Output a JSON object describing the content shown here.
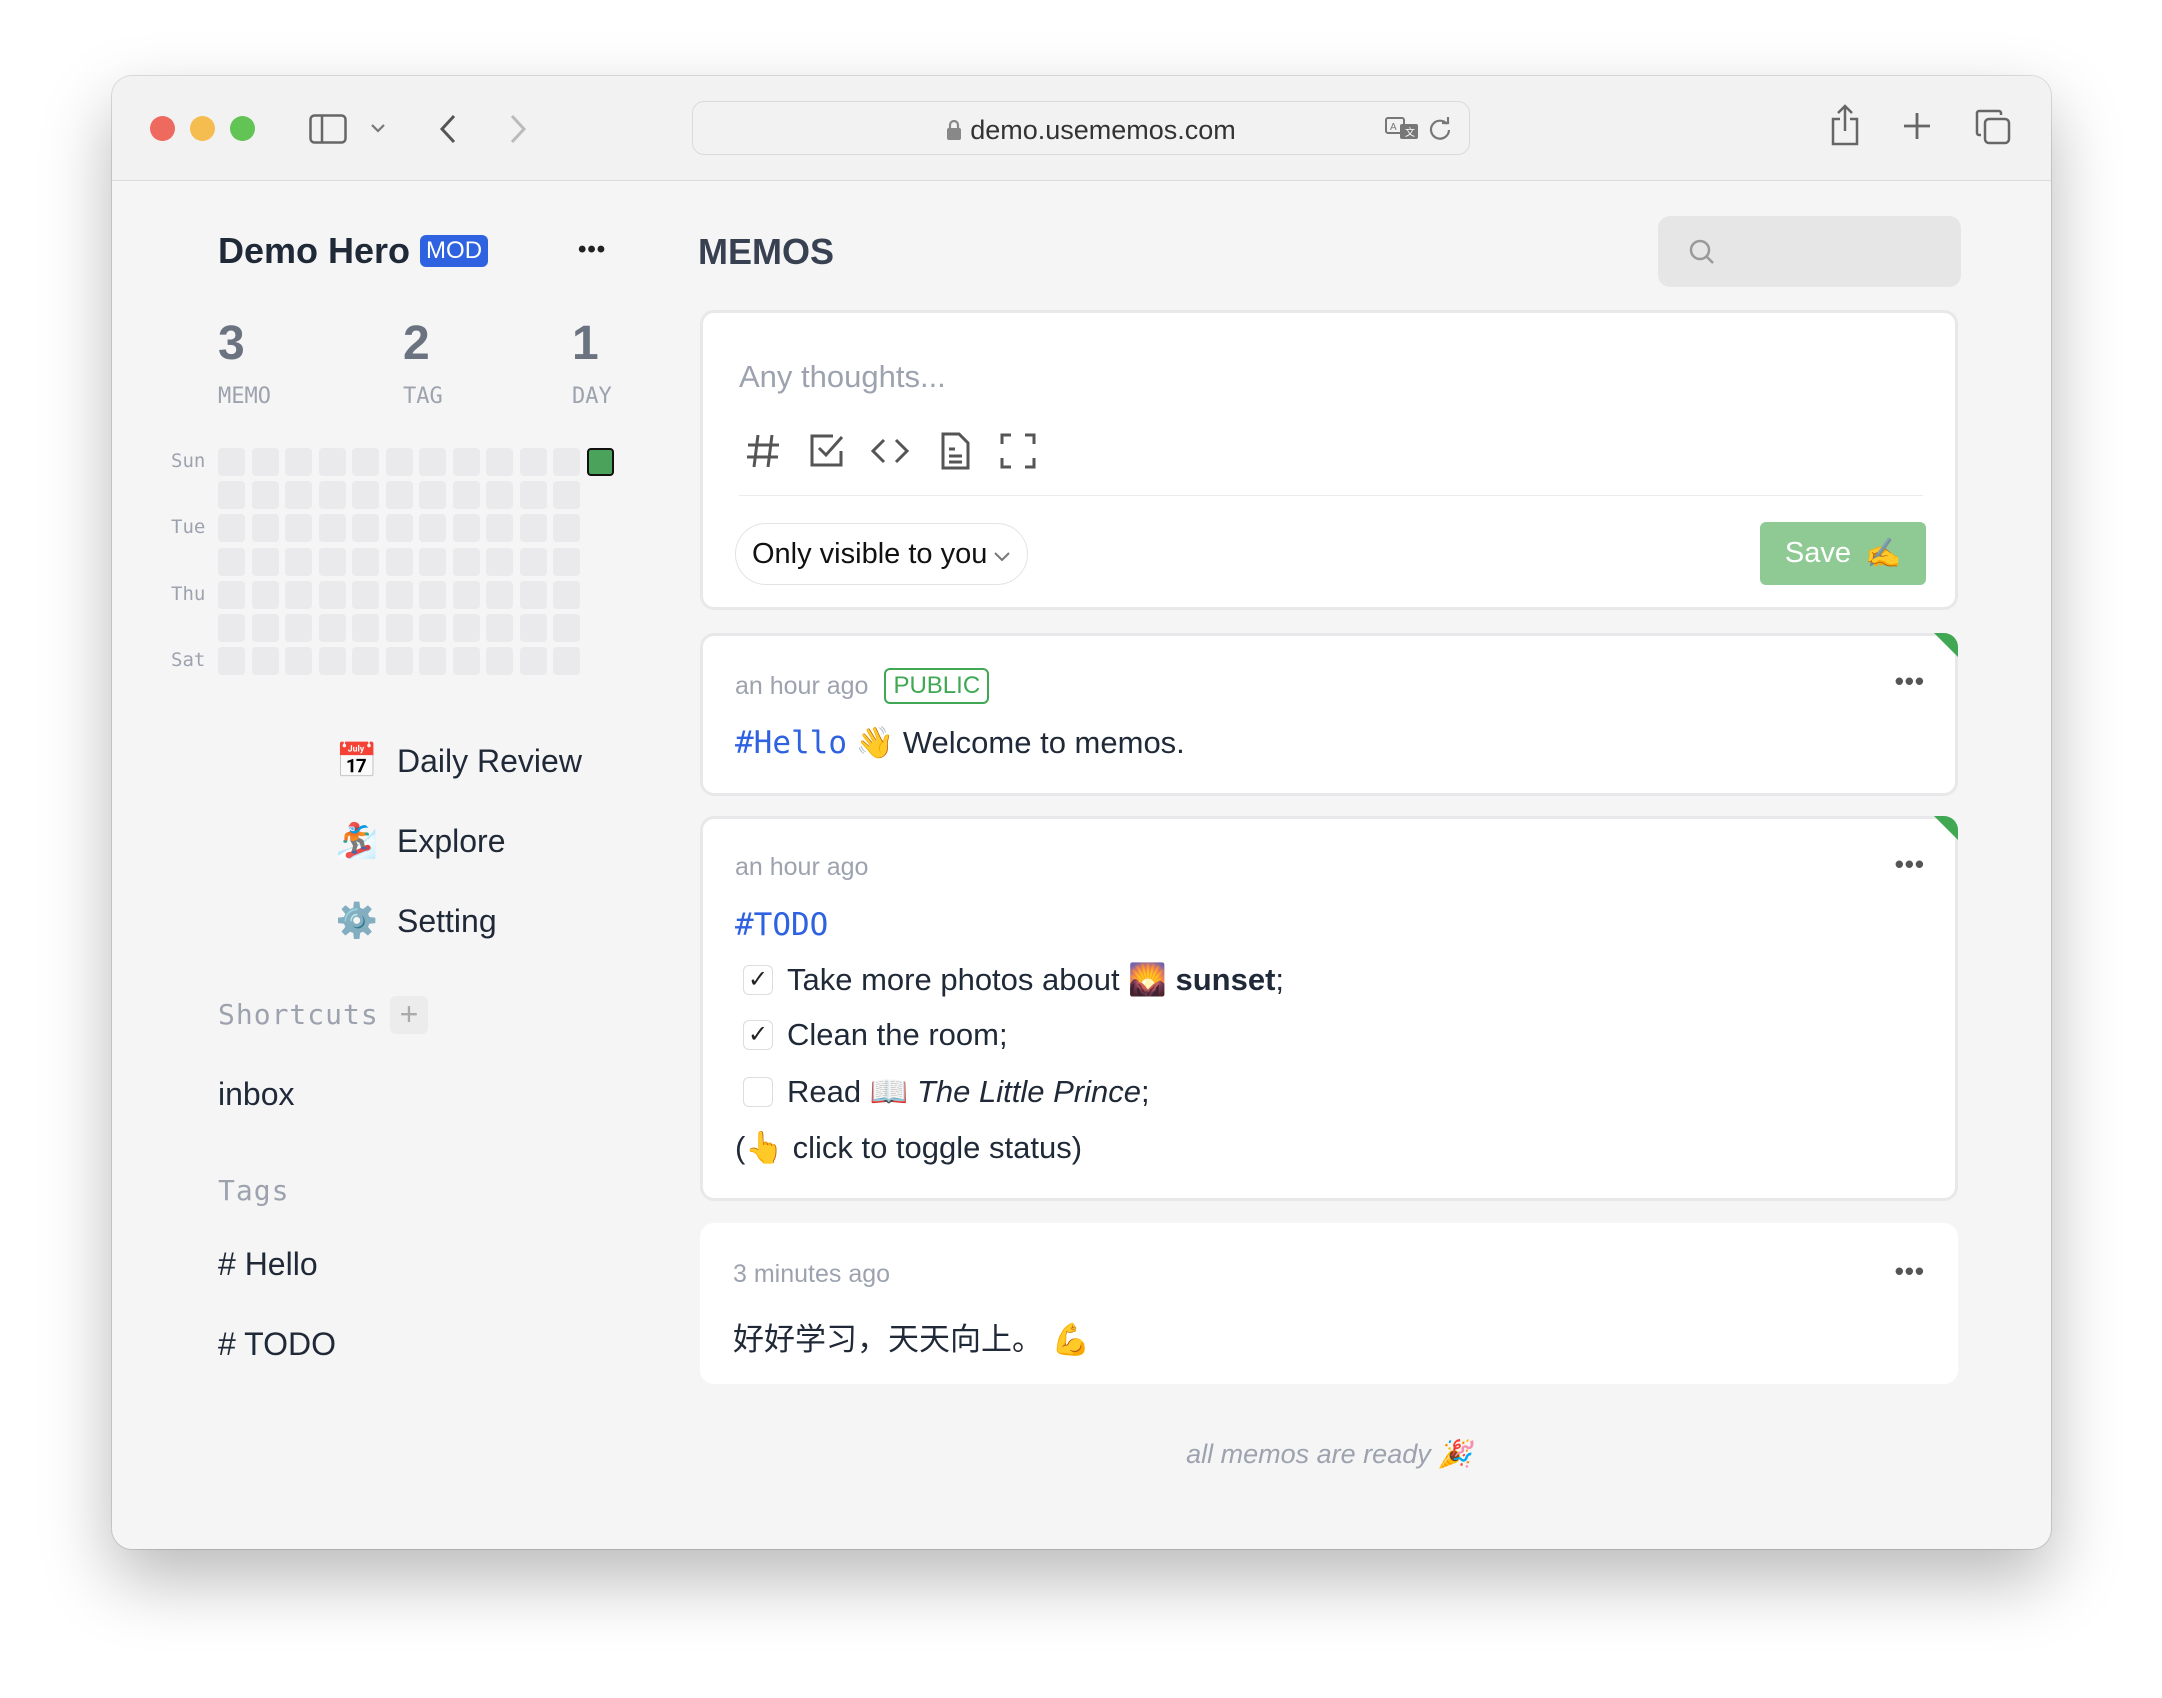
{
  "browser": {
    "url": "demo.usememos.com",
    "icons": [
      "sidebar-icon",
      "chevron-down-icon",
      "back-icon",
      "forward-icon",
      "lock-icon",
      "translate-icon",
      "reload-icon",
      "share-icon",
      "new-tab-icon",
      "tabs-overview-icon"
    ]
  },
  "sidebar": {
    "username": "Demo Hero",
    "role_badge": "MOD",
    "menu_label": "•••",
    "stats": [
      {
        "value": "3",
        "label": "MEMO"
      },
      {
        "value": "2",
        "label": "TAG"
      },
      {
        "value": "1",
        "label": "DAY"
      }
    ],
    "heatmap": {
      "day_labels": [
        "Sun",
        "Tue",
        "Thu",
        "Sat"
      ],
      "empty_color": "#eaeaec",
      "active_color": "#4ba25a"
    },
    "nav": [
      {
        "emoji": "📅",
        "label": "Daily Review"
      },
      {
        "emoji": "🏂",
        "label": "Explore"
      },
      {
        "emoji": "⚙️",
        "label": "Setting"
      }
    ],
    "shortcuts_title": "Shortcuts",
    "add_shortcut": "+",
    "shortcuts": [
      "inbox"
    ],
    "tags_title": "Tags",
    "tags": [
      "# Hello",
      "# TODO"
    ]
  },
  "main": {
    "title": "MEMOS",
    "search_placeholder": "",
    "editor": {
      "placeholder": "Any thoughts...",
      "tools": [
        "hash-icon",
        "checkbox-icon",
        "code-icon",
        "file-icon",
        "fullscreen-icon"
      ],
      "visibility": "Only visible to you",
      "save_label": "Save",
      "save_emoji": "✍️",
      "save_color": "#8fca95"
    },
    "memos": [
      {
        "time": "an hour ago",
        "badge": "PUBLIC",
        "tag": "#Hello",
        "emoji": "👋",
        "text": "Welcome to memos.",
        "menu": "•••"
      },
      {
        "time": "an hour ago",
        "tag": "#TODO",
        "menu": "•••",
        "todos": [
          {
            "checked": true,
            "text": "Take more photos about",
            "emoji": "🌄",
            "bold": "sunset",
            "suffix": ";"
          },
          {
            "checked": true,
            "text": "Clean the room;"
          },
          {
            "checked": false,
            "text": "Read",
            "emoji": "📖",
            "italic": "The Little Prince",
            "suffix": ";"
          }
        ],
        "note_open": "(",
        "note_emoji": "👆",
        "note_text": "click to toggle status)"
      },
      {
        "time": "3 minutes ago",
        "text": "好好学习，天天向上。",
        "emoji": "💪",
        "menu": "•••"
      }
    ],
    "footer": "all memos are ready",
    "footer_emoji": "🎉"
  },
  "colors": {
    "accent": "#2f62e0",
    "public_green": "#40a852"
  }
}
